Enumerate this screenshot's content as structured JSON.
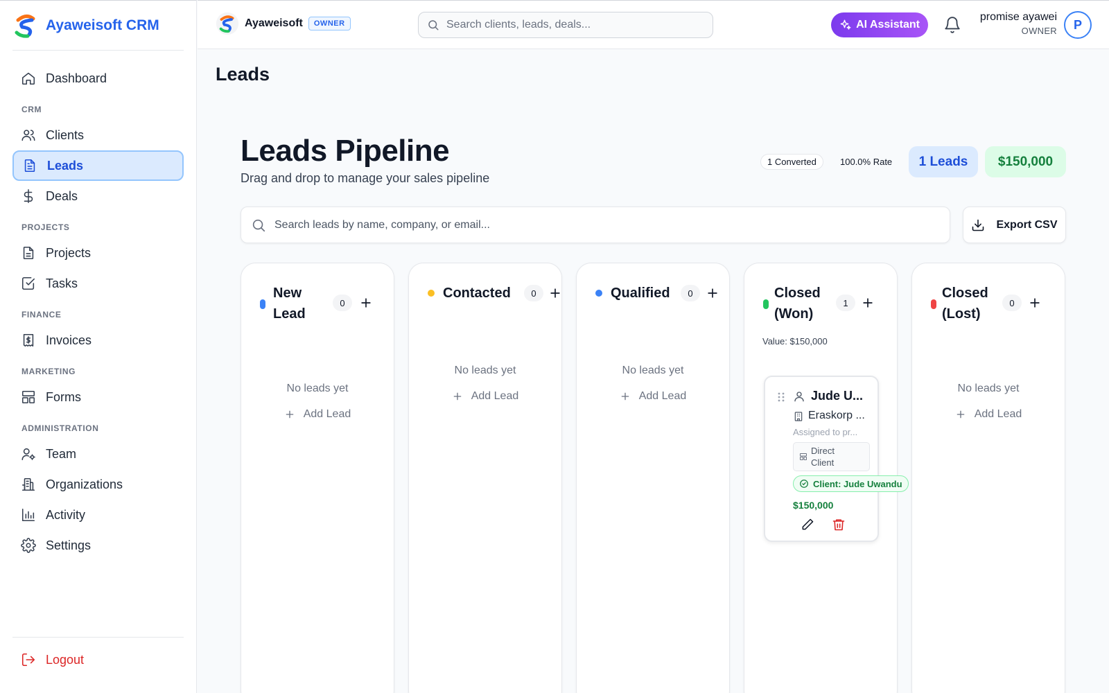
{
  "brand": {
    "name": "Ayaweisoft CRM"
  },
  "sidebar": {
    "dashboard": "Dashboard",
    "sections": {
      "crm": "CRM",
      "projects": "PROJECTS",
      "finance": "FINANCE",
      "marketing": "MARKETING",
      "administration": "ADMINISTRATION"
    },
    "items": {
      "clients": "Clients",
      "leads": "Leads",
      "deals": "Deals",
      "projects": "Projects",
      "tasks": "Tasks",
      "invoices": "Invoices",
      "forms": "Forms",
      "team": "Team",
      "organizations": "Organizations",
      "activity": "Activity",
      "settings": "Settings"
    },
    "logout": "Logout",
    "active_item": "Leads"
  },
  "topbar": {
    "org_name": "Ayaweisoft",
    "org_badge": "OWNER",
    "search_placeholder": "Search clients, leads, deals...",
    "ai_button": "AI Assistant",
    "user_name": "promise ayawei",
    "user_role": "OWNER",
    "avatar_initial": "P"
  },
  "page": {
    "title": "Leads",
    "pipeline_title": "Leads Pipeline",
    "pipeline_subtitle": "Drag and drop to manage your sales pipeline",
    "stats": {
      "converted": "1 Converted",
      "rate": "100.0% Rate",
      "leads": "1 Leads",
      "value": "$150,000"
    },
    "lead_search_placeholder": "Search leads by name, company, or email...",
    "export_button": "Export CSV"
  },
  "columns": [
    {
      "title_line1": "New",
      "title_line2": "Lead",
      "count": "0",
      "empty_text": "No leads yet",
      "add_label": "Add Lead",
      "color": "#3b82f6"
    },
    {
      "title": "Contacted",
      "count": "0",
      "empty_text": "No leads yet",
      "add_label": "Add Lead",
      "color": "#fbbf24"
    },
    {
      "title": "Qualified",
      "count": "0",
      "empty_text": "No leads yet",
      "add_label": "Add Lead",
      "color": "#3b82f6"
    },
    {
      "title_line1": "Closed",
      "title_line2": "(Won)",
      "count": "1",
      "value_text": "Value: $150,000",
      "color": "#22c55e",
      "card": {
        "name": "Jude U...",
        "company": "Eraskorp ...",
        "assigned": "Assigned to pr...",
        "source_line1": "Direct",
        "source_line2": "Client",
        "client": "Client: Jude Uwandu",
        "amount": "$150,000"
      }
    },
    {
      "title_line1": "Closed",
      "title_line2": "(Lost)",
      "count": "0",
      "empty_text": "No leads yet",
      "add_label": "Add Lead",
      "color": "#ef4444"
    }
  ],
  "colors": {
    "primary": "#2563eb",
    "ai_gradient_start": "#7c3aed",
    "success": "#15803d",
    "danger": "#dc2626"
  }
}
